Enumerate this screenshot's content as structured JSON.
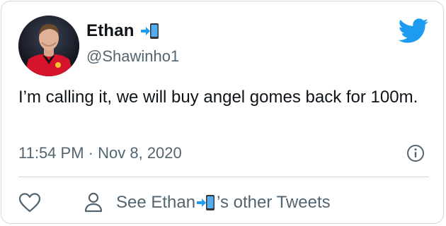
{
  "user": {
    "name": "Ethan",
    "handle": "@Shawinho1",
    "name_emoji_icon": "phone-with-arrow-icon"
  },
  "tweet": {
    "text": "I’m calling it, we will buy angel gomes back for 100m.",
    "time": "11:54 PM",
    "separator": "·",
    "date": "Nov 8, 2020"
  },
  "actions": {
    "see_prefix": "See Ethan ",
    "see_suffix": "’s other Tweets",
    "like_icon": "heart-icon",
    "profile_icon": "person-icon",
    "info_icon": "info-icon"
  },
  "colors": {
    "twitter_blue": "#1d9bf0",
    "text_primary": "#0f1419",
    "text_secondary": "#536471",
    "border": "#cfd9de"
  }
}
